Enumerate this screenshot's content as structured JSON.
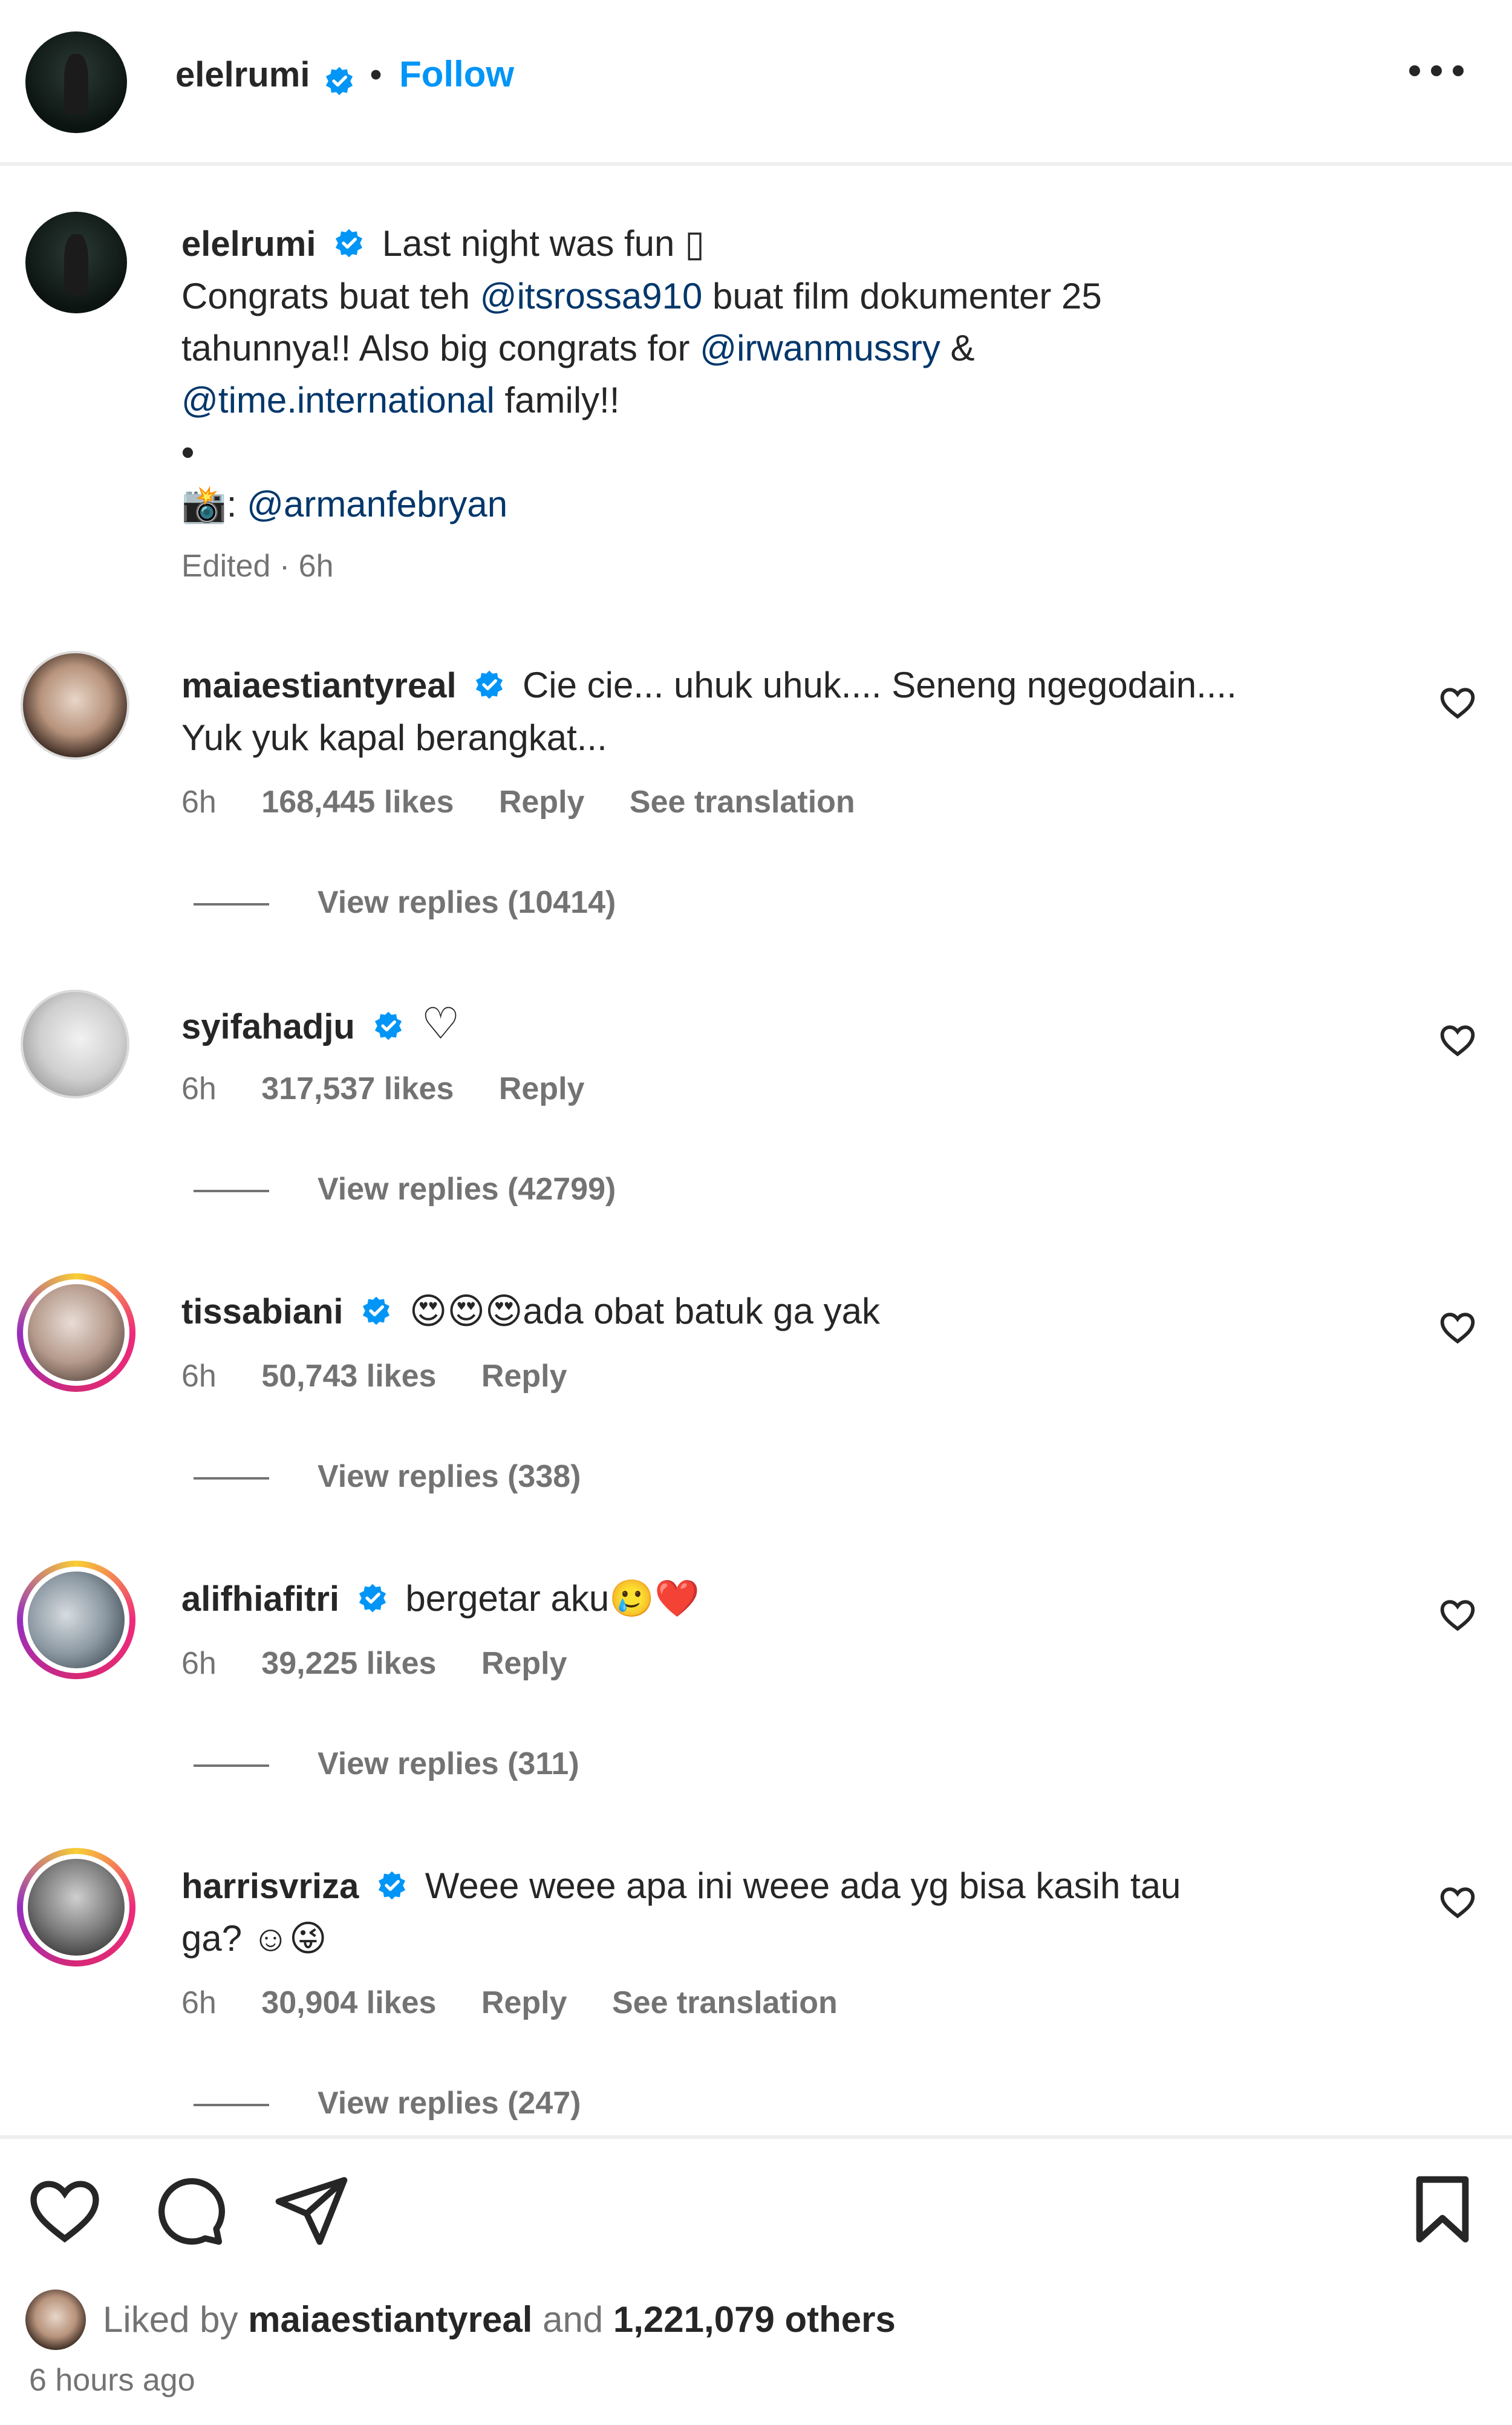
{
  "header": {
    "username": "elelrumi",
    "separator": "•",
    "follow_label": "Follow",
    "more_icon": "more-horizontal-icon"
  },
  "post": {
    "username": "elelrumi",
    "caption_line1": "Last night was fun ▯",
    "caption_line2_pre": "Congrats buat teh ",
    "mention1": "@itsrossa910",
    "caption_line2_post": " buat film dokumenter 25",
    "caption_line3_pre": "tahunnya!! Also big congrats for ",
    "mention2": "@irwanmussry",
    "caption_line3_post": " &",
    "mention3": "@time.international",
    "caption_line4_post": " family!!",
    "bullet": "•",
    "camera_icon": "📸",
    "credit_sep": ": ",
    "mention4": "@armanfebryan",
    "edited": "Edited · 6h"
  },
  "comments": [
    {
      "username": "maiaestiantyreal",
      "text_line1": "Cie cie... uhuk uhuk.... Seneng ngegodain....",
      "text_line2": "Yuk yuk kapal berangkat...",
      "time": "6h",
      "likes": "168,445 likes",
      "reply": "Reply",
      "translation": "See translation",
      "view_replies": "View replies (10414)"
    },
    {
      "username": "syifahadju",
      "text_line1": "♡",
      "time": "6h",
      "likes": "317,537 likes",
      "reply": "Reply",
      "view_replies": "View replies (42799)"
    },
    {
      "username": "tissabiani",
      "text_line1": "😍😍😍ada obat batuk ga yak",
      "time": "6h",
      "likes": "50,743 likes",
      "reply": "Reply",
      "view_replies": "View replies (338)"
    },
    {
      "username": "alifhiafitri",
      "text_line1": "bergetar aku🥲❤️",
      "time": "6h",
      "likes": "39,225 likes",
      "reply": "Reply",
      "view_replies": "View replies (311)"
    },
    {
      "username": "harrisvriza",
      "text_line1": "Weee weee apa ini weee ada yg bisa kasih tau",
      "text_line2": "ga? ☺😜",
      "time": "6h",
      "likes": "30,904 likes",
      "reply": "Reply",
      "translation": "See translation",
      "view_replies": "View replies (247)"
    }
  ],
  "footer": {
    "liked_prefix": "Liked by ",
    "liked_user": "maiaestiantyreal",
    "liked_mid": " and ",
    "liked_count": "1,221,079 others",
    "time_ago": "6 hours ago"
  },
  "colors": {
    "accent": "#0095f6",
    "mention": "#00376b",
    "verified": "#0095f6",
    "muted": "#737373"
  }
}
